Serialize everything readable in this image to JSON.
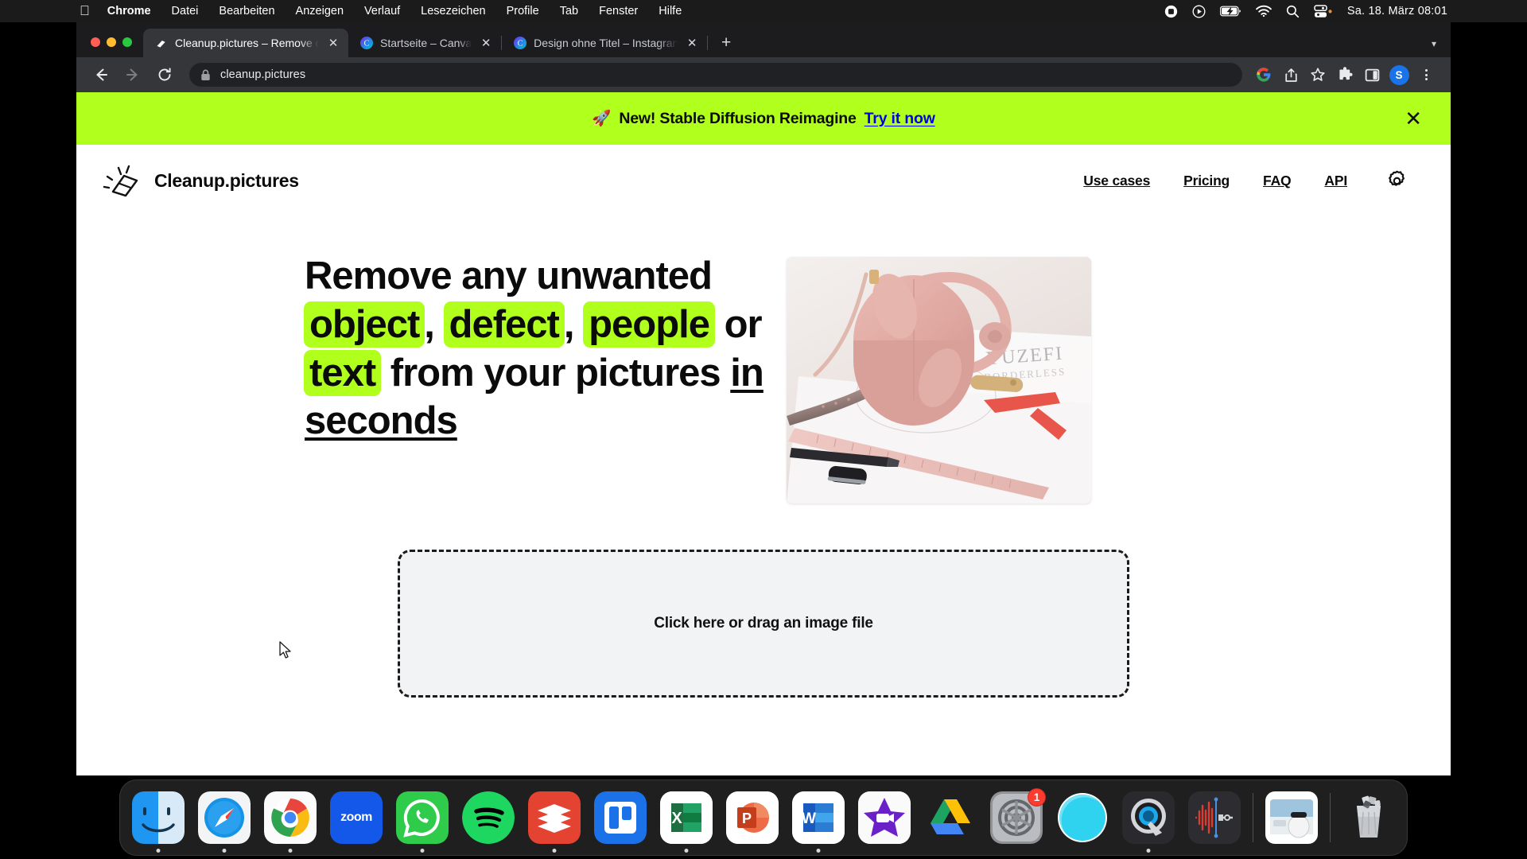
{
  "menubar": {
    "apple_icon": "apple-logo-icon",
    "items": [
      "Chrome",
      "Datei",
      "Bearbeiten",
      "Anzeigen",
      "Verlauf",
      "Lesezeichen",
      "Profile",
      "Tab",
      "Fenster",
      "Hilfe"
    ],
    "status_icons": [
      "screen-record-icon",
      "now-playing-icon",
      "battery-charging-icon",
      "wifi-icon",
      "search-icon",
      "control-center-icon"
    ],
    "clock": "Sa. 18. März  08:01"
  },
  "browser": {
    "tabs": [
      {
        "title": "Cleanup.pictures – Remove obj",
        "favicon": "eraser-icon",
        "active": true
      },
      {
        "title": "Startseite – Canva",
        "favicon": "canva-icon",
        "active": false
      },
      {
        "title": "Design ohne Titel – Instagram-",
        "favicon": "canva-icon",
        "active": false
      }
    ],
    "new_tab_label": "+",
    "tab_list_chevron": "▾",
    "back_icon": "←",
    "forward_icon": "→",
    "reload_icon": "⟳",
    "lock_icon": "lock-icon",
    "url": "cleanup.pictures",
    "toolbar_icons": [
      "google-lens-icon",
      "share-icon",
      "bookmark-star-icon",
      "extensions-puzzle-icon",
      "side-panel-icon"
    ],
    "profile_initial": "S",
    "menu_icon": "kebab-menu-icon"
  },
  "page": {
    "banner": {
      "emoji": "🚀",
      "text": "New! Stable Diffusion Reimagine",
      "cta": "Try it now",
      "close_icon": "close-icon",
      "background": "#b0ff1c"
    },
    "header": {
      "logo_icon": "eraser-logo-icon",
      "brand": "Cleanup.pictures",
      "nav": [
        "Use cases",
        "Pricing",
        "FAQ",
        "API"
      ],
      "settings_icon": "gear-icon"
    },
    "hero": {
      "headline_parts": [
        {
          "text": "Remove any unwanted",
          "style": "plain"
        },
        {
          "text": "object",
          "style": "highlight"
        },
        {
          "text": ", ",
          "style": "plain"
        },
        {
          "text": "defect",
          "style": "highlight"
        },
        {
          "text": ", ",
          "style": "plain"
        },
        {
          "text": "people",
          "style": "highlight"
        },
        {
          "text": " or ",
          "style": "plain"
        },
        {
          "text": "text",
          "style": "highlight"
        },
        {
          "text": " from your pictures ",
          "style": "plain"
        },
        {
          "text": "in seconds",
          "style": "underline"
        }
      ],
      "headline_line1": "Remove any unwanted",
      "hl_object": "object",
      "hl_defect": "defect",
      "hl_people": "people",
      "hl_text": "text",
      "mid_text": " from your pictures ",
      "underlined": "in seconds",
      "comma": ", ",
      "or_text": " or ",
      "image_alt": "pink leather handbag on desk with ruler, pen and YUZEFI paper",
      "image_paper_text": "YUZEFI",
      "highlight_color": "#b0ff1c"
    },
    "dropzone": {
      "label": "Click here or drag an image file"
    }
  },
  "dock": {
    "items": [
      {
        "name": "Finder",
        "icon": "finder-icon",
        "running": true
      },
      {
        "name": "Safari",
        "icon": "safari-icon",
        "running": true
      },
      {
        "name": "Google Chrome",
        "icon": "chrome-icon",
        "running": true
      },
      {
        "name": "zoom",
        "icon": "zoom-icon",
        "label": "zoom",
        "running": false
      },
      {
        "name": "WhatsApp",
        "icon": "whatsapp-icon",
        "running": true
      },
      {
        "name": "Spotify",
        "icon": "spotify-icon",
        "running": false
      },
      {
        "name": "Todoist",
        "icon": "todoist-icon",
        "running": true
      },
      {
        "name": "Trello",
        "icon": "trello-icon",
        "running": false
      },
      {
        "name": "Microsoft Excel",
        "icon": "excel-icon",
        "label": "X",
        "running": true
      },
      {
        "name": "Microsoft PowerPoint",
        "icon": "powerpoint-icon",
        "label": "P",
        "running": false
      },
      {
        "name": "Microsoft Word",
        "icon": "word-icon",
        "label": "W",
        "running": true
      },
      {
        "name": "iMovie",
        "icon": "imovie-icon",
        "running": false
      },
      {
        "name": "Google Drive",
        "icon": "google-drive-icon",
        "running": false
      },
      {
        "name": "Systemeinstellungen",
        "icon": "system-settings-icon",
        "badge": "1",
        "running": false
      },
      {
        "name": "Ivory",
        "icon": "blue-circle-app-icon",
        "running": false
      },
      {
        "name": "QuickTime Player",
        "icon": "quicktime-icon",
        "running": true
      },
      {
        "name": "Audio Hijack",
        "icon": "audio-waveform-icon",
        "running": false
      }
    ],
    "minimized": [
      {
        "name": "Screenshot",
        "icon": "screenshot-thumbnail-icon"
      }
    ],
    "trash": {
      "name": "Papierkorb",
      "icon": "trash-full-icon"
    }
  }
}
